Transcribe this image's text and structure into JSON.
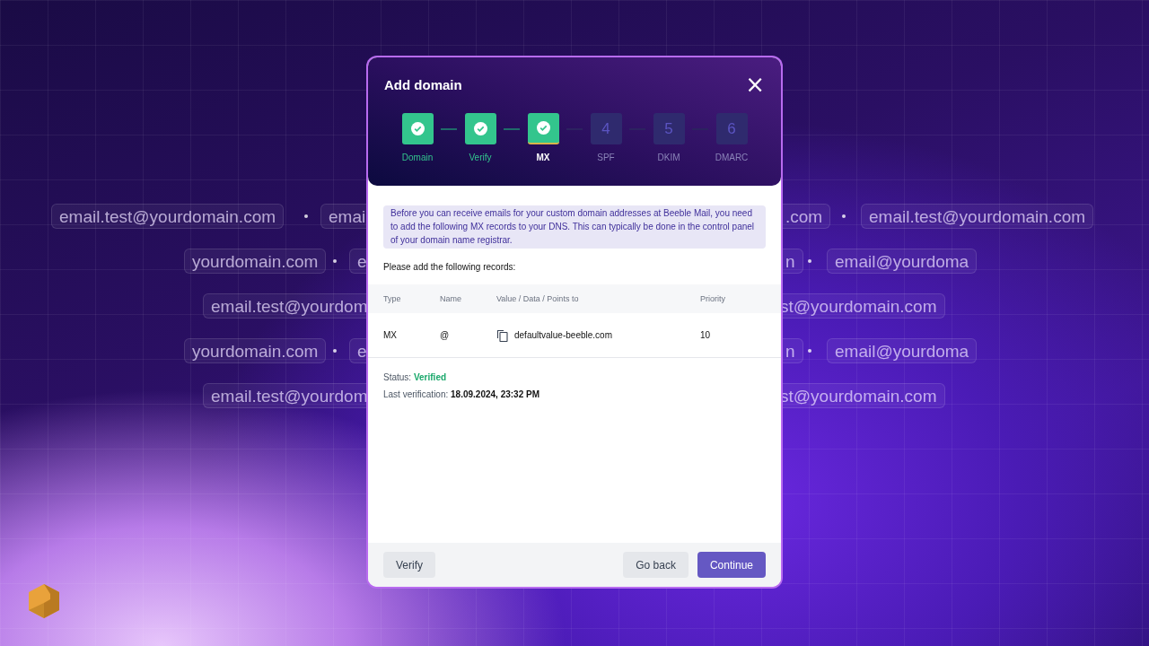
{
  "background_rows": [
    {
      "left": [
        "email.test@yourdomain.com",
        "emai"
      ],
      "right": [
        ".com",
        "email.test@yourdomain.com"
      ]
    },
    {
      "left": [
        "yourdomain.com",
        "e"
      ],
      "right": [
        "n",
        "email@yourdoma"
      ]
    },
    {
      "left": [
        "email.test@yourdom"
      ],
      "right": [
        "st@yourdomain.com"
      ]
    },
    {
      "left": [
        "yourdomain.com",
        "e"
      ],
      "right": [
        "n",
        "email@yourdoma"
      ]
    },
    {
      "left": [
        "email.test@yourdom"
      ],
      "right": [
        "st@yourdomain.com"
      ]
    }
  ],
  "dialog": {
    "title": "Add domain",
    "close": "×",
    "steps": [
      {
        "label": "Domain",
        "completed": true,
        "selected": false
      },
      {
        "label": "Verify",
        "completed": true,
        "selected": false
      },
      {
        "label": "MX",
        "completed": true,
        "selected": true
      },
      {
        "label": "SPF",
        "completed": false,
        "selected": false,
        "number": "4"
      },
      {
        "label": "DKIM",
        "completed": false,
        "selected": false,
        "number": "5"
      },
      {
        "label": "DMARC",
        "completed": false,
        "selected": false,
        "number": "6"
      }
    ],
    "notice": "Before you can receive emails for your custom domain addresses at Beeble Mail, you need to add the following MX records to your DNS. This can typically be done in the control panel of your domain name registrar.",
    "instruction": "Please add the following records:",
    "table": {
      "columns": [
        "Type",
        "Name",
        "Value / Data / Points to",
        "Priority"
      ],
      "rows": [
        {
          "type": "MX",
          "name": "@",
          "value": "defaultvalue-beeble.com",
          "priority": "10"
        }
      ]
    },
    "status_label": "Status:",
    "status_value": "Verified",
    "verification_label": "Last verification:",
    "verification_value": "18.09.2024, 23:32 PM",
    "buttons": {
      "verify": "Verify",
      "back": "Go back",
      "continue": "Continue"
    }
  }
}
